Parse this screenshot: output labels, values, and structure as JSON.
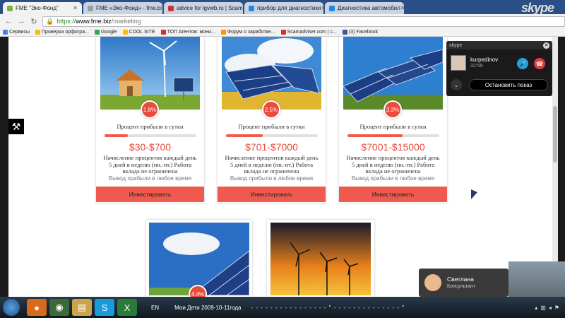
{
  "browser": {
    "tabs": [
      {
        "label": "FME \"Эко-Фонд\"",
        "active": true,
        "color": "#7cb342"
      },
      {
        "label": "FME «Эко-Фонд» - fme.bi",
        "active": false,
        "color": "#9e9e9e"
      },
      {
        "label": "advice for lgvwb.ru | Scam",
        "active": false,
        "color": "#d32f2f"
      },
      {
        "label": "прибор для диагностики",
        "active": false,
        "color": "#1e88e5"
      },
      {
        "label": "Диагностика автомобил",
        "active": false,
        "color": "#1e88e5"
      }
    ],
    "window_brand": "skype",
    "url_scheme": "https://",
    "url_host": "www.fme.biz",
    "url_path": "/marketing",
    "bookmarks": [
      {
        "label": "Сервисы",
        "color": "#4285f4"
      },
      {
        "label": "Проверка орфогра...",
        "color": "#fbbc05"
      },
      {
        "label": "Google",
        "color": "#34a853"
      },
      {
        "label": "COOL SITE",
        "color": "#fbbc05"
      },
      {
        "label": "ТОП Агентов: мони...",
        "color": "#d32f2f"
      },
      {
        "label": "Форум о заработке...",
        "color": "#ff9800"
      },
      {
        "label": "Scamadviser.com | c...",
        "color": "#d32f2f"
      },
      {
        "label": "(3) Facebook",
        "color": "#3b5998"
      }
    ]
  },
  "plans": [
    {
      "badge": "1.8%",
      "label": "Процент прибыли в сутки",
      "progress": 0.25,
      "range": "$30-$700",
      "desc": "Начисление процентов каждый день 5 дней в неделю (пн.-пт.) Работа вклада не ограничена",
      "note": "Вывод прибыли в любое время",
      "button": "Инвестировать"
    },
    {
      "badge": "2.5%",
      "label": "Процент прибыли в сутки",
      "progress": 0.4,
      "range": "$701-$7000",
      "desc": "Начисление процентов каждый день 5 дней в неделю (пн.-пт.) Работа вклада не ограничена",
      "note": "Вывод прибыли в любое время",
      "button": "Инвестировать"
    },
    {
      "badge": "3.3%",
      "label": "Процент прибыли в сутки",
      "progress": 0.6,
      "range": "$7001-$15000",
      "desc": "Начисление процентов каждый день 5 дней в неделю (пн.-пт.) Работа вклада не ограничена",
      "note": "Вывод прибыли в любое время",
      "button": "Инвестировать"
    }
  ],
  "plans_row2": [
    {
      "badge": "4.4%"
    },
    {
      "badge": ""
    }
  ],
  "skype_call": {
    "app": "skype",
    "name": "kurpedinov",
    "time": "32:59",
    "stop_label": "Остановить показ"
  },
  "consultant": {
    "name": "Светлана",
    "role": "Консультант"
  },
  "taskbar": {
    "lang": "EN",
    "now_playing": "Мои Дети 2009-10-11года",
    "ticker": "- - - - - - - - - - - - - - - - \" - - - - - - - - - - - - - - \""
  }
}
